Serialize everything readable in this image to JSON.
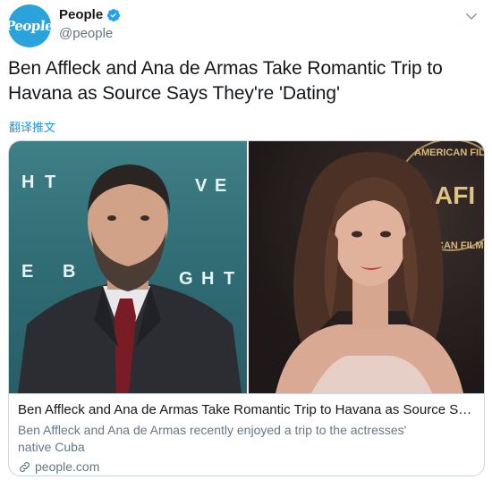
{
  "account": {
    "avatar_text": "People",
    "display_name": "People",
    "handle": "@people"
  },
  "tweet": {
    "text": "Ben Affleck and Ana de Armas Take Romantic Trip to Havana as Source Says They're 'Dating'",
    "translate_label": "翻译推文"
  },
  "card": {
    "photo_left": {
      "backdrop_letters": [
        "H",
        "T",
        "V",
        "E",
        "E",
        "B",
        "G",
        "H",
        "T"
      ]
    },
    "photo_right": {
      "backdrop_text_top": "AMERICAN FILM",
      "backdrop_logo": "AFI",
      "backdrop_text_side": "CAN FILM"
    },
    "title": "Ben Affleck and Ana de Armas Take Romantic Trip to Havana as Source Says Th...",
    "description": "Ben Affleck and Ana de Armas recently enjoyed a trip to the actresses' native Cuba",
    "domain": "people.com"
  },
  "colors": {
    "brand": "#2aa3dd",
    "link": "#1b95e0",
    "verified": "#1da1f2",
    "muted": "#657786"
  }
}
